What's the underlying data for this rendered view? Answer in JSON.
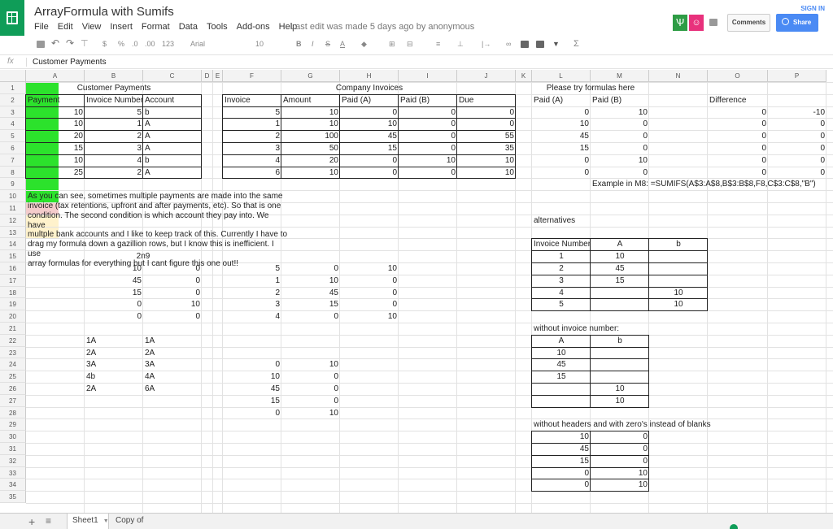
{
  "doc_title": "ArrayFormula with Sumifs",
  "menu": [
    "File",
    "Edit",
    "View",
    "Insert",
    "Format",
    "Data",
    "Tools",
    "Add-ons",
    "Help"
  ],
  "last_edit": "Last edit was made 5 days ago by anonymous",
  "sign_in": "SIGN IN",
  "comments_label": "Comments",
  "share_label": "Share",
  "toolbar": {
    "font": "Arial",
    "size": "10",
    "percent": "%",
    "dec0": ".0",
    "dec00": ".00",
    "num": "123",
    "currency": "$",
    "bold": "B",
    "italic": "I",
    "strike": "S",
    "sigma": "Σ"
  },
  "formula_bar": {
    "fx": "fx",
    "value": "Customer Payments"
  },
  "columns": [
    "A",
    "B",
    "C",
    "D",
    "E",
    "F",
    "G",
    "H",
    "I",
    "J",
    "K",
    "L",
    "M",
    "N",
    "O",
    "P"
  ],
  "rows": [
    "1",
    "2",
    "3",
    "4",
    "5",
    "6",
    "7",
    "8",
    "9",
    "10",
    "11",
    "12",
    "13",
    "14",
    "15",
    "16",
    "17",
    "18",
    "19",
    "20",
    "21",
    "22",
    "23",
    "24",
    "25",
    "26",
    "27",
    "28",
    "29",
    "30",
    "31",
    "32",
    "33",
    "34",
    "35"
  ],
  "cells": {
    "a1": "Customer Payments",
    "f1": "Company Invoices",
    "l1": "Please try formulas here",
    "hdr2": [
      "Payment",
      "Invoice Number",
      "Account",
      "Invoice",
      "Amount",
      "Paid (A)",
      "Paid (B)",
      "Due",
      "Paid (A)",
      "Paid (B)",
      "Difference"
    ],
    "cust": [
      [
        "10",
        "5",
        "b"
      ],
      [
        "10",
        "1",
        "A"
      ],
      [
        "20",
        "2",
        "A"
      ],
      [
        "15",
        "3",
        "A"
      ],
      [
        "10",
        "4",
        "b"
      ],
      [
        "25",
        "2",
        "A"
      ]
    ],
    "inv": [
      [
        "5",
        "10",
        "0",
        "0",
        "0"
      ],
      [
        "1",
        "10",
        "10",
        "0",
        "0"
      ],
      [
        "2",
        "100",
        "45",
        "0",
        "55"
      ],
      [
        "3",
        "50",
        "15",
        "0",
        "35"
      ],
      [
        "4",
        "20",
        "0",
        "10",
        "10"
      ],
      [
        "6",
        "10",
        "0",
        "0",
        "10"
      ]
    ],
    "try": [
      [
        "0",
        "10"
      ],
      [
        "10",
        "0"
      ],
      [
        "45",
        "0"
      ],
      [
        "15",
        "0"
      ],
      [
        "0",
        "10"
      ],
      [
        "0",
        "0"
      ]
    ],
    "diff": [
      [
        "0",
        "-10"
      ],
      [
        "0",
        "0"
      ],
      [
        "0",
        "0"
      ],
      [
        "0",
        "0"
      ],
      [
        "0",
        "0"
      ],
      [
        "0",
        "0"
      ]
    ],
    "example": "Example in M8: =SUMIFS(A$3:A$8,B$3:B$8,F8,C$3:C$8,\"B\")",
    "note": [
      "As you can see, sometimes multiple payments are made into the same",
      "invoice (tax retentions, upfront and after payments, etc). So that is one",
      "condition. The second condition is which account they pay into. We have",
      "multple bank accounts and I like to keep track of this. Currently I have to",
      "drag my formula down a gazillion rows, but I know this is inefficient. I use",
      "array formulas for everything but I cant figure this one out!!"
    ],
    "alternatives": "alternatives",
    "b15": "2n9",
    "bc": [
      [
        "10",
        "0"
      ],
      [
        "45",
        "0"
      ],
      [
        "15",
        "0"
      ],
      [
        "0",
        "10"
      ],
      [
        "0",
        "0"
      ]
    ],
    "fgh": [
      [
        "5",
        "0",
        "10"
      ],
      [
        "1",
        "10",
        "0"
      ],
      [
        "2",
        "45",
        "0"
      ],
      [
        "3",
        "15",
        "0"
      ],
      [
        "4",
        "0",
        "10"
      ]
    ],
    "alt_hdr": [
      "Invoice Number",
      "A",
      "b"
    ],
    "alt": [
      [
        "1",
        "10",
        ""
      ],
      [
        "2",
        "45",
        ""
      ],
      [
        "3",
        "15",
        ""
      ],
      [
        "4",
        "",
        "10"
      ],
      [
        "5",
        "",
        "10"
      ]
    ],
    "without_inv": "without invoice number:",
    "wi_hdr": [
      "A",
      "b"
    ],
    "wi": [
      [
        "10",
        ""
      ],
      [
        "45",
        ""
      ],
      [
        "15",
        ""
      ],
      [
        "",
        "10"
      ],
      [
        "",
        "10"
      ]
    ],
    "bc22": [
      [
        "1A",
        "1A"
      ],
      [
        "2A",
        "2A"
      ],
      [
        "3A",
        "3A"
      ],
      [
        "4b",
        "4A"
      ],
      [
        "2A",
        "6A"
      ]
    ],
    "fg24": [
      [
        "0",
        "10"
      ],
      [
        "10",
        "0"
      ],
      [
        "45",
        "0"
      ],
      [
        "15",
        "0"
      ],
      [
        "0",
        "10"
      ]
    ],
    "without_hdr": "without headers and with zero's instead of blanks",
    "wh": [
      [
        "10",
        "0"
      ],
      [
        "45",
        "0"
      ],
      [
        "15",
        "0"
      ],
      [
        "0",
        "10"
      ],
      [
        "0",
        "10"
      ]
    ]
  },
  "sheets": [
    "Sheet1",
    "Copy of Sheet1"
  ],
  "colors": {
    "green": "#2ce22c",
    "pink": "#f4cccc",
    "yellow": "#fff2cc",
    "brand": "#0f9d58",
    "share": "#4a8af4"
  }
}
